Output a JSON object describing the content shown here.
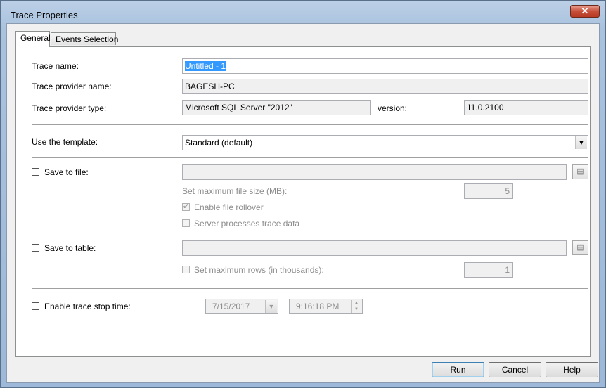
{
  "window": {
    "title": "Trace Properties",
    "close_glyph": "✕"
  },
  "tabs": [
    {
      "label": "General"
    },
    {
      "label": "Events Selection"
    }
  ],
  "general": {
    "trace_name_label": "Trace name:",
    "trace_name_value": "Untitled - 1",
    "provider_name_label": "Trace provider name:",
    "provider_name_value": "BAGESH-PC",
    "provider_type_label": "Trace provider type:",
    "provider_type_value": "Microsoft SQL Server \"2012\"",
    "version_label": "version:",
    "version_value": "11.0.2100",
    "template_label": "Use the template:",
    "template_value": "Standard (default)",
    "save_file_label": "Save to file:",
    "max_file_size_label": "Set maximum file size (MB):",
    "max_file_size_value": "5",
    "file_rollover_label": "Enable file rollover",
    "server_processes_label": "Server processes trace data",
    "save_table_label": "Save to table:",
    "max_rows_label": "Set maximum rows (in thousands):",
    "max_rows_value": "1",
    "stop_time_label": "Enable trace stop time:",
    "stop_date_value": "7/15/2017",
    "stop_time_value": "9:16:18 PM"
  },
  "buttons": {
    "run": "Run",
    "cancel": "Cancel",
    "help": "Help"
  },
  "icons": {
    "dropdown": "chevron-down-icon",
    "browse": "browse-folder-icon",
    "spin": "spin-updown-icon"
  }
}
